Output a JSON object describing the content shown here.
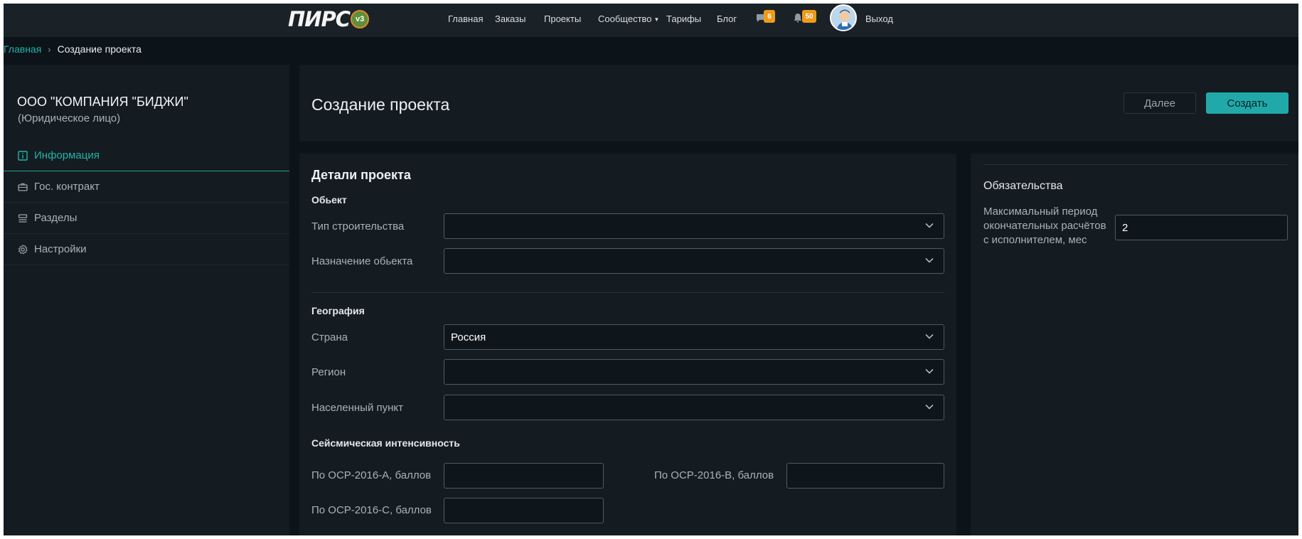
{
  "topnav": {
    "logo_text": "ПИРС",
    "logo_badge": "v3",
    "links": [
      "Главная",
      "Заказы",
      "Проекты",
      "Сообщество",
      "Тарифы",
      "Блог"
    ],
    "messages_count": "6",
    "notifications_count": "50",
    "logout": "Выход",
    "badge_color": "#f09a1a"
  },
  "breadcrumb": {
    "home": "Главная",
    "separator": "›",
    "current": "Создание проекта"
  },
  "sidebar": {
    "company_name": "ООО \"КОМПАНИЯ \"БИДЖИ\"",
    "company_type": "(Юридическое лицо)",
    "items": [
      {
        "label": "Информация",
        "icon": "info-icon",
        "active": true
      },
      {
        "label": "Гос. контракт",
        "icon": "briefcase-icon",
        "active": false
      },
      {
        "label": "Разделы",
        "icon": "sections-icon",
        "active": false
      },
      {
        "label": "Настройки",
        "icon": "gear-icon",
        "active": false
      }
    ],
    "accent_color": "#23b3a7"
  },
  "header": {
    "title": "Создание проекта",
    "next_label": "Далее",
    "create_label": "Создать"
  },
  "details": {
    "title": "Детали проекта",
    "object": {
      "title": "Обьект",
      "construction_type_label": "Тип строительства",
      "construction_type_value": "",
      "purpose_label": "Назначение обьекта",
      "purpose_value": ""
    },
    "geography": {
      "title": "География",
      "country_label": "Страна",
      "country_value": "Россия",
      "region_label": "Регион",
      "region_value": "",
      "locality_label": "Населенный пункт",
      "locality_value": ""
    },
    "seismic": {
      "title": "Сейсмическая интенсивность",
      "a_label": "По ОСР-2016-А, баллов",
      "a_value": "",
      "b_label": "По ОСР-2016-В, баллов",
      "b_value": "",
      "c_label": "По ОСР-2016-С, баллов",
      "c_value": ""
    }
  },
  "obligations": {
    "title": "Обязательства",
    "period_label": "Максимальный период окончательных расчётов с исполнителем, мес",
    "period_value": "2"
  }
}
